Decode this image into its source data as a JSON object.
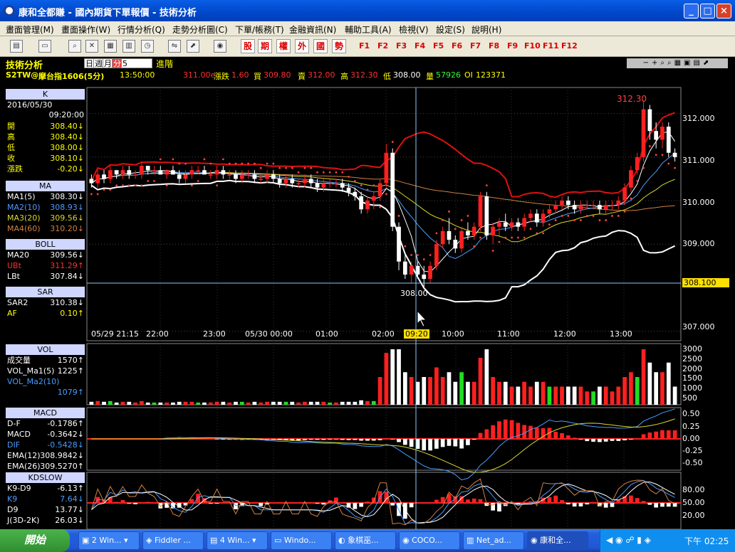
{
  "window": {
    "title": "康和全都賺 - 國內期貨下單報價 - 技術分析"
  },
  "menu": [
    "畫面管理(M)",
    "畫面操作(W)",
    "行情分析(Q)",
    "走勢分析圖(C)",
    "下單/帳務(T)",
    "金融資訊(N)",
    "輔助工具(A)",
    "檢視(V)",
    "設定(S)",
    "說明(H)"
  ],
  "toolbar": {
    "red_buttons": [
      "股",
      "期",
      "權",
      "外",
      "國",
      "勢"
    ],
    "fkeys": [
      "F1",
      "F2",
      "F3",
      "F4",
      "F5",
      "F6",
      "F7",
      "F8",
      "F9",
      "F10",
      "F11",
      "F12"
    ]
  },
  "chartbar": {
    "label": "技術分析",
    "periods": [
      "日",
      "週",
      "月",
      "分"
    ],
    "active_period": "分",
    "interval": "5",
    "advanced": "進階"
  },
  "quote": {
    "symbol": "S2TW@",
    "name": "摩台指1606(5分)",
    "time": "13:50:00",
    "last": "311.00e",
    "change_label": "漲跌",
    "change": "1.60",
    "bid_label": "買",
    "bid": "309.80",
    "ask_label": "賣",
    "ask": "312.00",
    "high_label": "高",
    "high": "312.30",
    "low_label": "低",
    "low": "308.00",
    "vol_label": "量",
    "vol": "57926",
    "oi_label": "OI",
    "oi": "123371"
  },
  "sidebar": {
    "k": {
      "title": "K",
      "date": "2016/05/30",
      "time": "09:20:00",
      "rows": [
        {
          "k": "開",
          "v": "308.40↓"
        },
        {
          "k": "高",
          "v": "308.40↓"
        },
        {
          "k": "低",
          "v": "308.00↓"
        },
        {
          "k": "收",
          "v": "308.10↓"
        },
        {
          "k": "漲跌",
          "v": "-0.20↓"
        }
      ]
    },
    "ma": {
      "title": "MA",
      "rows": [
        {
          "k": "MA1(5)",
          "v": "308.30↓"
        },
        {
          "k": "MA2(10)",
          "v": "308.93↓"
        },
        {
          "k": "MA3(20)",
          "v": "309.56↓"
        },
        {
          "k": "MA4(60)",
          "v": "310.20↓"
        }
      ]
    },
    "boll": {
      "title": "BOLL",
      "rows": [
        {
          "k": "MA20",
          "v": "309.56↓"
        },
        {
          "k": "UBt",
          "v": "311.29↑"
        },
        {
          "k": "LBt",
          "v": "307.84↓"
        }
      ]
    },
    "sar": {
      "title": "SAR",
      "rows": [
        {
          "k": "SAR2",
          "v": "310.38↓"
        },
        {
          "k": "AF",
          "v": "0.10↑"
        }
      ]
    },
    "vol": {
      "title": "VOL",
      "rows": [
        {
          "k": "成交量",
          "v": "1570↑"
        },
        {
          "k": "VOL_Ma1(5)",
          "v": "1225↑"
        },
        {
          "k": "VOL_Ma2(10)",
          "v": ""
        },
        {
          "k": "",
          "v": "1079↑"
        }
      ]
    },
    "macd": {
      "title": "MACD",
      "rows": [
        {
          "k": "D-F",
          "v": "-0.1786↑"
        },
        {
          "k": "MACD",
          "v": "-0.3642↓"
        },
        {
          "k": "DIF",
          "v": "-0.5428↓"
        },
        {
          "k": "EMA(12)",
          "v": "308.9842↓"
        },
        {
          "k": "EMA(26)",
          "v": "309.5270↑"
        }
      ]
    },
    "kd": {
      "title": "KDSLOW",
      "rows": [
        {
          "k": "K9-D9",
          "v": "-6.13↑"
        },
        {
          "k": "K9",
          "v": "7.64↓"
        },
        {
          "k": "D9",
          "v": "13.77↓"
        },
        {
          "k": "J(3D-2K)",
          "v": "26.03↓"
        }
      ]
    }
  },
  "price_axis": [
    "312.000",
    "311.000",
    "310.000",
    "309.000",
    "308.100",
    "307.000"
  ],
  "time_axis": [
    "05/29 21:15",
    "22:00",
    "23:00",
    "05/30 00:00",
    "01:00",
    "02:00",
    "09:20",
    "10:00",
    "11:00",
    "12:00",
    "13:00"
  ],
  "annotations": {
    "high": "312.30",
    "low": "308.00"
  },
  "vol_axis": [
    "3000",
    "2500",
    "2000",
    "1500",
    "1000",
    "500"
  ],
  "macd_axis": [
    "0.50",
    "0.25",
    "0.00",
    "-0.25",
    "-0.50"
  ],
  "kd_axis": [
    "80.00",
    "50.00",
    "20.00"
  ],
  "colors": {
    "up": "#ff2020",
    "down": "#ffffff",
    "boll_upper": "#e01010",
    "boll_lower": "#ffffff",
    "sar": "#ff4040",
    "ma5": "#ffffff",
    "ma10": "#4a9cff",
    "ma20": "#d8d830",
    "ma60": "#d08040",
    "vol_up": "#ff2020",
    "vol_green": "#22dd22"
  },
  "chart_data": {
    "type": "candlestick",
    "y_range": [
      306.8,
      312.6
    ],
    "candles": [
      [
        310.5,
        310.6,
        310.3,
        310.4
      ],
      [
        310.4,
        310.7,
        310.3,
        310.6
      ],
      [
        310.6,
        310.7,
        310.4,
        310.5
      ],
      [
        310.5,
        310.8,
        310.4,
        310.7
      ],
      [
        310.7,
        310.7,
        310.5,
        310.6
      ],
      [
        310.6,
        310.8,
        310.5,
        310.7
      ],
      [
        310.7,
        310.8,
        310.5,
        310.6
      ],
      [
        310.6,
        310.7,
        310.5,
        310.6
      ],
      [
        310.6,
        310.9,
        310.5,
        310.8
      ],
      [
        310.8,
        310.8,
        310.6,
        310.7
      ],
      [
        310.7,
        310.8,
        310.6,
        310.7
      ],
      [
        310.7,
        310.8,
        310.6,
        310.6
      ],
      [
        310.6,
        310.7,
        310.5,
        310.7
      ],
      [
        310.7,
        310.8,
        310.6,
        310.6
      ],
      [
        310.6,
        310.7,
        310.4,
        310.5
      ],
      [
        310.5,
        310.7,
        310.4,
        310.6
      ],
      [
        310.6,
        310.8,
        310.5,
        310.7
      ],
      [
        310.7,
        310.8,
        310.6,
        310.7
      ],
      [
        310.7,
        310.8,
        310.6,
        310.6
      ],
      [
        310.6,
        310.7,
        310.5,
        310.6
      ],
      [
        310.6,
        310.8,
        310.5,
        310.7
      ],
      [
        310.7,
        310.8,
        310.5,
        310.6
      ],
      [
        310.6,
        310.7,
        310.5,
        310.6
      ],
      [
        310.6,
        310.7,
        310.4,
        310.5
      ],
      [
        310.5,
        310.7,
        310.4,
        310.6
      ],
      [
        310.6,
        310.7,
        310.5,
        310.6
      ],
      [
        310.6,
        310.7,
        310.4,
        310.5
      ],
      [
        310.5,
        310.6,
        310.4,
        310.5
      ],
      [
        310.5,
        310.7,
        310.4,
        310.6
      ],
      [
        310.6,
        310.7,
        310.4,
        310.5
      ],
      [
        310.5,
        310.6,
        310.3,
        310.4
      ],
      [
        310.4,
        310.6,
        310.3,
        310.5
      ],
      [
        310.5,
        310.6,
        310.3,
        310.4
      ],
      [
        310.4,
        310.5,
        310.3,
        310.4
      ],
      [
        310.4,
        310.6,
        310.3,
        310.5
      ],
      [
        310.5,
        310.6,
        310.3,
        310.4
      ],
      [
        310.4,
        310.5,
        310.2,
        310.3
      ],
      [
        310.3,
        310.5,
        310.2,
        310.4
      ],
      [
        310.4,
        310.5,
        310.3,
        310.4
      ],
      [
        310.4,
        310.5,
        310.3,
        310.4
      ],
      [
        310.4,
        310.5,
        310.2,
        310.3
      ],
      [
        310.3,
        310.4,
        310.1,
        310.2
      ],
      [
        310.2,
        310.3,
        310.0,
        310.1
      ],
      [
        310.1,
        310.2,
        309.7,
        309.8
      ],
      [
        309.8,
        310.1,
        309.7,
        310.0
      ],
      [
        310.0,
        310.2,
        309.8,
        310.1
      ],
      [
        310.1,
        310.5,
        310.0,
        310.4
      ],
      [
        310.4,
        311.3,
        310.3,
        311.1
      ],
      [
        311.1,
        311.2,
        309.3,
        309.4
      ],
      [
        309.4,
        309.5,
        308.4,
        308.6
      ],
      [
        308.6,
        308.8,
        308.2,
        308.3
      ],
      [
        308.3,
        308.6,
        308.1,
        308.5
      ],
      [
        308.5,
        308.6,
        308.2,
        308.3
      ],
      [
        308.3,
        308.5,
        308.0,
        308.2
      ],
      [
        308.2,
        308.6,
        308.1,
        308.5
      ],
      [
        308.5,
        309.1,
        308.4,
        309.0
      ],
      [
        309.0,
        309.4,
        308.9,
        309.3
      ],
      [
        309.3,
        309.6,
        309.0,
        309.1
      ],
      [
        309.1,
        309.2,
        308.8,
        308.9
      ],
      [
        308.9,
        309.4,
        308.8,
        309.3
      ],
      [
        309.3,
        309.5,
        309.1,
        309.2
      ],
      [
        309.2,
        309.5,
        309.1,
        309.4
      ],
      [
        309.4,
        310.2,
        309.3,
        310.1
      ],
      [
        310.1,
        310.2,
        309.1,
        309.2
      ],
      [
        309.2,
        309.5,
        309.0,
        309.4
      ],
      [
        309.4,
        309.6,
        309.2,
        309.5
      ],
      [
        309.5,
        309.7,
        309.3,
        309.4
      ],
      [
        309.4,
        309.6,
        309.3,
        309.5
      ],
      [
        309.5,
        309.6,
        309.3,
        309.4
      ],
      [
        309.4,
        309.7,
        309.3,
        309.6
      ],
      [
        309.6,
        309.8,
        309.5,
        309.7
      ],
      [
        309.7,
        309.8,
        309.4,
        309.5
      ],
      [
        309.5,
        309.8,
        309.4,
        309.7
      ],
      [
        309.7,
        309.9,
        309.6,
        309.8
      ],
      [
        309.8,
        310.0,
        309.7,
        309.9
      ],
      [
        309.9,
        310.1,
        309.8,
        310.0
      ],
      [
        310.0,
        310.1,
        309.8,
        309.9
      ],
      [
        309.9,
        310.0,
        309.7,
        309.8
      ],
      [
        309.8,
        310.0,
        309.7,
        309.9
      ],
      [
        309.9,
        310.0,
        309.8,
        309.9
      ],
      [
        309.9,
        310.0,
        309.8,
        309.9
      ],
      [
        309.9,
        310.0,
        309.7,
        309.8
      ],
      [
        309.8,
        310.0,
        309.7,
        309.9
      ],
      [
        309.9,
        310.0,
        309.8,
        309.9
      ],
      [
        309.9,
        310.1,
        309.8,
        310.0
      ],
      [
        310.0,
        310.4,
        309.9,
        310.3
      ],
      [
        310.3,
        310.8,
        310.2,
        310.7
      ],
      [
        310.7,
        311.1,
        310.6,
        311.0
      ],
      [
        311.0,
        312.3,
        310.9,
        312.1
      ],
      [
        312.1,
        312.2,
        311.4,
        311.6
      ],
      [
        311.6,
        311.8,
        311.2,
        311.4
      ],
      [
        311.4,
        311.8,
        311.2,
        311.7
      ],
      [
        311.7,
        311.8,
        311.0,
        311.1
      ],
      [
        311.1,
        311.2,
        310.9,
        311.0
      ]
    ]
  }
}
